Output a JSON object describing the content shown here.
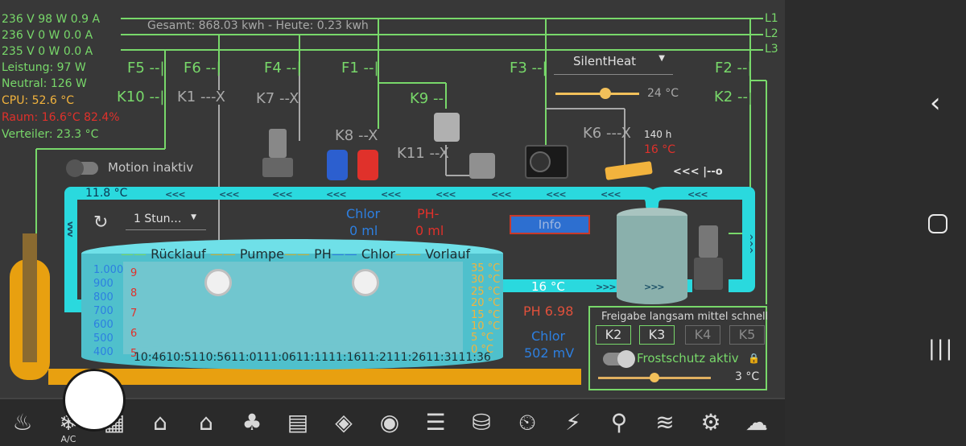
{
  "status": {
    "l1_reading": "236 V 98 W 0.9 A",
    "l2_reading": "236 V 0 W 0.0 A",
    "l3_reading": "235 V 0 W 0.0 A",
    "leistung": "Leistung: 97 W",
    "neutral": "Neutral: 126 W",
    "cpu": "CPU: 52.6 °C",
    "raum": "Raum: 16.6°C 82.4%",
    "verteiler": "Verteiler: 23.3 °C"
  },
  "energy": {
    "summary": "Gesamt: 868.03 kwh - Heute: 0.23 kwh"
  },
  "phases": {
    "l1": "L1",
    "l2": "L2",
    "l3": "L3"
  },
  "fuses": {
    "f5": "F5",
    "f6": "F6",
    "f4": "F4",
    "f1": "F1",
    "f3": "F3",
    "f2": "F2"
  },
  "relays": {
    "k10": "K10",
    "k1": "K1",
    "k7": "K7",
    "k9": "K9",
    "k8": "K8",
    "k11": "K11",
    "k6": "K6",
    "k2": "K2"
  },
  "heatpump": {
    "mode": "SilentHeat",
    "setpoint": "24 °C",
    "slider_fraction": 0.6
  },
  "solar": {
    "hours": "140 h",
    "temp": "16 °C",
    "direction": "<<< |--o"
  },
  "motion": {
    "label": "Motion inaktiv",
    "enabled": false
  },
  "pipes": {
    "return_temp": "11.8 °C",
    "flow_temp": "16 °C",
    "arrows_left": "<<<",
    "arrows_right": ">>>",
    "arrows_down": "vvv",
    "arrows_up": "^^^"
  },
  "dosing": {
    "chlor_label": "Chlor",
    "chlor_value": "0 ml",
    "ph_label": "PH-",
    "ph_value": "0 ml"
  },
  "info_button": "Info",
  "chart": {
    "range_select": "1 Stun…",
    "legend": {
      "ruecklauf": "Rücklauf",
      "pumpe": "Pumpe",
      "ph": "PH",
      "chlor": "Chlor",
      "vorlauf": "Vorlauf"
    },
    "left_axis_blue": [
      "1.000",
      "900",
      "800",
      "700",
      "600",
      "500",
      "400"
    ],
    "left_axis_red": [
      "9",
      "8",
      "7",
      "6",
      "5"
    ],
    "right_axis": [
      "35 °C",
      "30 °C",
      "25 °C",
      "20 °C",
      "15 °C",
      "10 °C",
      "5 °C",
      "0 °C"
    ],
    "time_axis": "10:4610:5110:5611:0111:0611:1111:1611:2111:2611:3111:36"
  },
  "water": {
    "ph": "PH 6.98",
    "chlor_label": "Chlor",
    "chlor_mv": "502 mV"
  },
  "pump_panel": {
    "title": "Freigabe langsam mittel schnell",
    "buttons": [
      "K2",
      "K3",
      "K4",
      "K5"
    ],
    "frost_label": "Frostschutz aktiv",
    "frost_enabled": true,
    "frost_temp": "3 °C",
    "frost_slider_fraction": 0.5
  },
  "toolbar": {
    "icons": [
      "heating-icon",
      "ac-icon",
      "building-icon",
      "house-ground-icon",
      "house-up-icon",
      "tree-icon",
      "document-list-icon",
      "shield-icon",
      "webcam-icon",
      "list-icon",
      "database-sync-icon",
      "clock-display-icon",
      "weather-lightning-icon",
      "water-tap-icon",
      "pool-icon",
      "gear-icon",
      "rain-cloud-icon"
    ],
    "ac_label": "A/C"
  },
  "colors": {
    "background": "#383838",
    "green": "#78d86a",
    "cyan": "#2ad9de",
    "red": "#e0312b",
    "orange": "#f2b33d",
    "blue": "#2d7fe0"
  }
}
